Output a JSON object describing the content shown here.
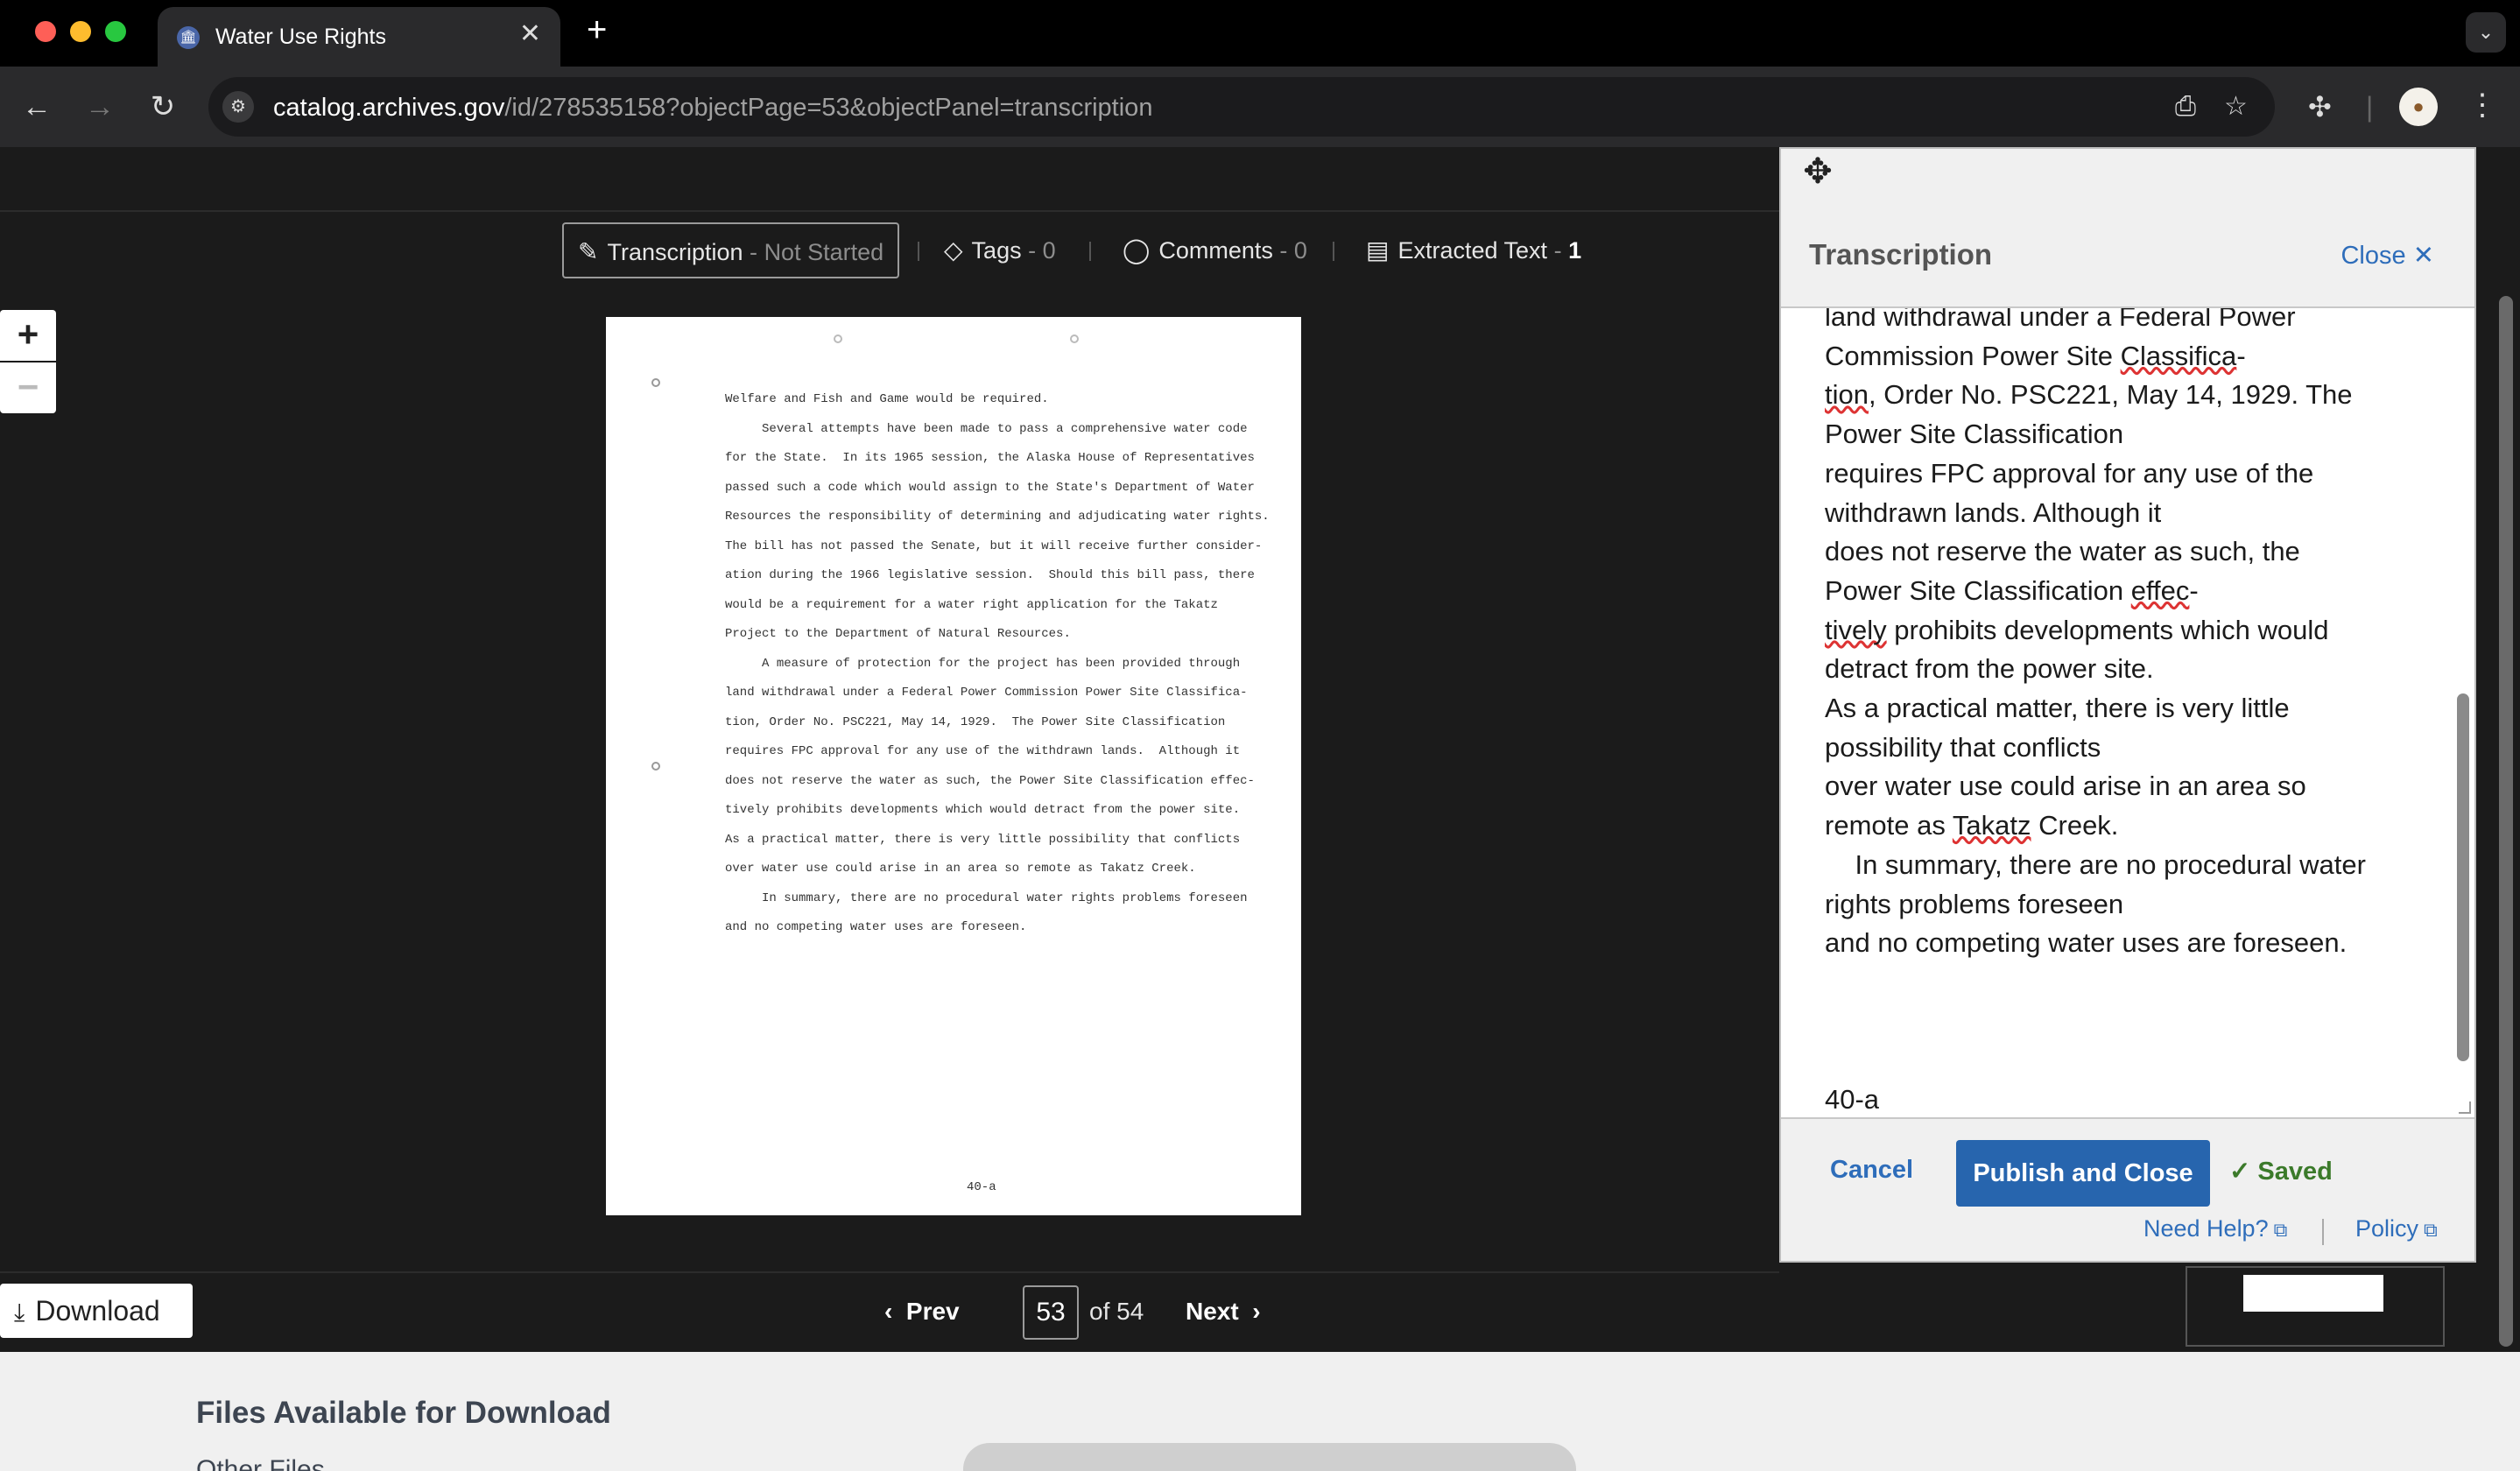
{
  "browser": {
    "tab_title": "Water Use Rights",
    "tab_close": "✕",
    "new_tab": "+",
    "url_host": "catalog.archives.gov",
    "url_path": "/id/278535158?objectPage=53&objectPanel=transcription"
  },
  "viewer": {
    "tabs": {
      "transcription": {
        "label": "Transcription",
        "status": "Not Started",
        "sep": "-"
      },
      "tags": {
        "label": "Tags",
        "count": "0",
        "sep": "-"
      },
      "comments": {
        "label": "Comments",
        "count": "0",
        "sep": "-"
      },
      "extracted": {
        "label": "Extracted Text",
        "count": "1",
        "sep": "-"
      }
    },
    "zoom_in": "+",
    "zoom_out": "−",
    "document": {
      "lines": [
        "Welfare and Fish and Game would be required.",
        "     Several attempts have been made to pass a comprehensive water code",
        "for the State.  In its 1965 session, the Alaska House of Representatives",
        "passed such a code which would assign to the State's Department of Water",
        "Resources the responsibility of determining and adjudicating water rights.",
        "The bill has not passed the Senate, but it will receive further consider-",
        "ation during the 1966 legislative session.  Should this bill pass, there",
        "would be a requirement for a water right application for the Takatz",
        "Project to the Department of Natural Resources.",
        "     A measure of protection for the project has been provided through",
        "land withdrawal under a Federal Power Commission Power Site Classifica-",
        "tion, Order No. PSC221, May 14, 1929.  The Power Site Classification",
        "requires FPC approval for any use of the withdrawn lands.  Although it",
        "does not reserve the water as such, the Power Site Classification effec-",
        "tively prohibits developments which would detract from the power site.",
        "As a practical matter, there is very little possibility that conflicts",
        "over water use could arise in an area so remote as Takatz Creek.",
        "     In summary, there are no procedural water rights problems foreseen",
        "and no competing water uses are foreseen."
      ],
      "folio": "40-a"
    },
    "download_label": "Download",
    "pager": {
      "prev": "Prev",
      "current": "53",
      "of_text": "of 54",
      "next": "Next"
    }
  },
  "panel": {
    "title": "Transcription",
    "close_label": "Close",
    "transcription": {
      "l1": "land withdrawal under a Federal Power",
      "l2a": "Commission Power Site ",
      "l2b": "Classifica",
      "l2c": "-",
      "l3a": "tion",
      "l3b": ", Order No. PSC221, May 14, 1929. The",
      "l4": "Power Site Classification",
      "l5": "requires FPC approval for any use of the",
      "l6": "withdrawn lands. Although it",
      "l7": "does not reserve the water as such, the",
      "l8a": "Power Site Classification ",
      "l8b": "effec",
      "l8c": "-",
      "l9a": "tively",
      "l9b": " prohibits developments which would",
      "l10": "detract from the power site.",
      "l11": "As a practical matter, there is very little",
      "l12": "possibility that conflicts",
      "l13": "over water use could arise in an area so",
      "l14a": "remote as ",
      "l14b": "Takatz",
      "l14c": " Creek.",
      "l15": "    In summary, there are no procedural water",
      "l16": "rights problems foreseen",
      "l17": "and no competing water uses are foreseen.",
      "l18": "40-a"
    },
    "cancel_label": "Cancel",
    "publish_label": "Publish and Close",
    "saved_label": "✓ Saved",
    "need_help": "Need Help?",
    "policy": "Policy"
  },
  "lower": {
    "heading": "Files Available for Download",
    "other_files": "Other Files"
  },
  "colors": {
    "accent_blue": "#2765ae",
    "link_blue": "#2e6dba",
    "saved_green": "#3b7a2a"
  }
}
